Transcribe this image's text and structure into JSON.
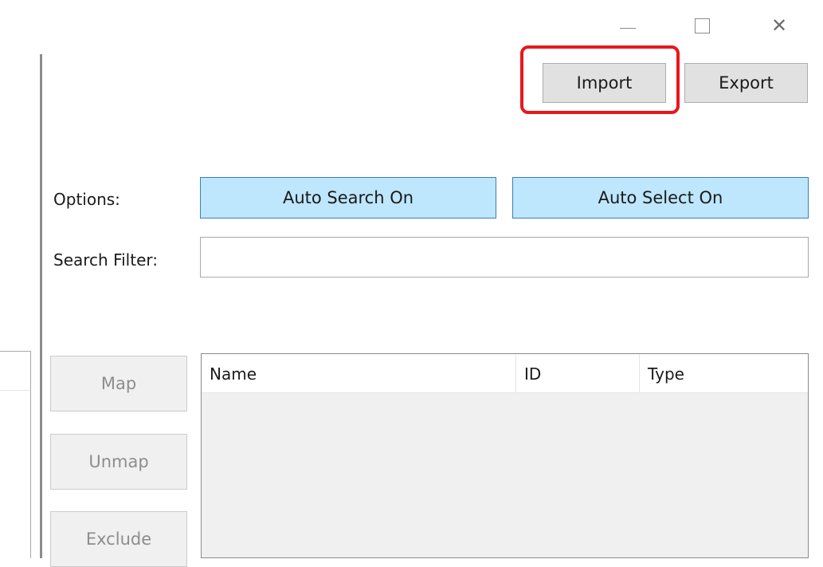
{
  "window": {
    "minimize_icon": "minimize-icon",
    "maximize_icon": "maximize-icon",
    "close_glyph": "✕"
  },
  "toolbar": {
    "import_label": "Import",
    "export_label": "Export",
    "highlight_color": "#e8171c"
  },
  "options": {
    "label": "Options:",
    "auto_search_label": "Auto Search On",
    "auto_select_label": "Auto Select On",
    "toggle_color": "#bee6fd"
  },
  "search": {
    "label": "Search Filter:",
    "value": ""
  },
  "actions": {
    "map_label": "Map",
    "unmap_label": "Unmap",
    "exclude_label": "Exclude"
  },
  "list": {
    "columns": [
      "Name",
      "ID",
      "Type"
    ],
    "rows": []
  }
}
